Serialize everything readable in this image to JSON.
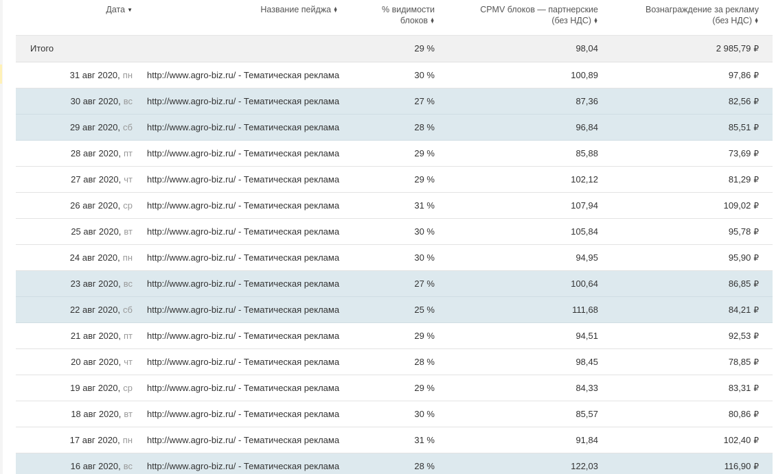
{
  "columns": {
    "date": "Дата",
    "page_name": "Название пейджа",
    "visibility_l1": "% видимости",
    "visibility_l2": "блоков",
    "cpmv_l1": "CPMV блоков — партнерские",
    "cpmv_l2": "(без НДС)",
    "reward_l1": "Вознаграждение за рекламу",
    "reward_l2": "(без НДС)"
  },
  "sort_icons": {
    "date": "▼",
    "others": "▲▼"
  },
  "total": {
    "label": "Итого",
    "visibility": "29 %",
    "cpmv": "98,04",
    "reward": "2 985,79"
  },
  "currency": "₽",
  "rows": [
    {
      "date": "31 авг 2020",
      "weekday": "пн",
      "page": "http://www.agro-biz.ru/ - Тематическая реклама",
      "visibility": "30 %",
      "cpmv": "100,89",
      "reward": "97,86",
      "weekend": false
    },
    {
      "date": "30 авг 2020",
      "weekday": "вс",
      "page": "http://www.agro-biz.ru/ - Тематическая реклама",
      "visibility": "27 %",
      "cpmv": "87,36",
      "reward": "82,56",
      "weekend": true
    },
    {
      "date": "29 авг 2020",
      "weekday": "сб",
      "page": "http://www.agro-biz.ru/ - Тематическая реклама",
      "visibility": "28 %",
      "cpmv": "96,84",
      "reward": "85,51",
      "weekend": true
    },
    {
      "date": "28 авг 2020",
      "weekday": "пт",
      "page": "http://www.agro-biz.ru/ - Тематическая реклама",
      "visibility": "29 %",
      "cpmv": "85,88",
      "reward": "73,69",
      "weekend": false
    },
    {
      "date": "27 авг 2020",
      "weekday": "чт",
      "page": "http://www.agro-biz.ru/ - Тематическая реклама",
      "visibility": "29 %",
      "cpmv": "102,12",
      "reward": "81,29",
      "weekend": false
    },
    {
      "date": "26 авг 2020",
      "weekday": "ср",
      "page": "http://www.agro-biz.ru/ - Тематическая реклама",
      "visibility": "31 %",
      "cpmv": "107,94",
      "reward": "109,02",
      "weekend": false
    },
    {
      "date": "25 авг 2020",
      "weekday": "вт",
      "page": "http://www.agro-biz.ru/ - Тематическая реклама",
      "visibility": "30 %",
      "cpmv": "105,84",
      "reward": "95,78",
      "weekend": false
    },
    {
      "date": "24 авг 2020",
      "weekday": "пн",
      "page": "http://www.agro-biz.ru/ - Тематическая реклама",
      "visibility": "30 %",
      "cpmv": "94,95",
      "reward": "95,90",
      "weekend": false
    },
    {
      "date": "23 авг 2020",
      "weekday": "вс",
      "page": "http://www.agro-biz.ru/ - Тематическая реклама",
      "visibility": "27 %",
      "cpmv": "100,64",
      "reward": "86,85",
      "weekend": true
    },
    {
      "date": "22 авг 2020",
      "weekday": "сб",
      "page": "http://www.agro-biz.ru/ - Тематическая реклама",
      "visibility": "25 %",
      "cpmv": "111,68",
      "reward": "84,21",
      "weekend": true
    },
    {
      "date": "21 авг 2020",
      "weekday": "пт",
      "page": "http://www.agro-biz.ru/ - Тематическая реклама",
      "visibility": "29 %",
      "cpmv": "94,51",
      "reward": "92,53",
      "weekend": false
    },
    {
      "date": "20 авг 2020",
      "weekday": "чт",
      "page": "http://www.agro-biz.ru/ - Тематическая реклама",
      "visibility": "28 %",
      "cpmv": "98,45",
      "reward": "78,85",
      "weekend": false
    },
    {
      "date": "19 авг 2020",
      "weekday": "ср",
      "page": "http://www.agro-biz.ru/ - Тематическая реклама",
      "visibility": "29 %",
      "cpmv": "84,33",
      "reward": "83,31",
      "weekend": false
    },
    {
      "date": "18 авг 2020",
      "weekday": "вт",
      "page": "http://www.agro-biz.ru/ - Тематическая реклама",
      "visibility": "30 %",
      "cpmv": "85,57",
      "reward": "80,86",
      "weekend": false
    },
    {
      "date": "17 авг 2020",
      "weekday": "пн",
      "page": "http://www.agro-biz.ru/ - Тематическая реклама",
      "visibility": "31 %",
      "cpmv": "91,84",
      "reward": "102,40",
      "weekend": false
    },
    {
      "date": "16 авг 2020",
      "weekday": "вс",
      "page": "http://www.agro-biz.ru/ - Тематическая реклама",
      "visibility": "28 %",
      "cpmv": "122,03",
      "reward": "116,90",
      "weekend": true
    }
  ],
  "colors": {
    "weekend_row": "#dde9ee",
    "total_row": "#f1f1f1",
    "weekday_text": "#999999"
  }
}
